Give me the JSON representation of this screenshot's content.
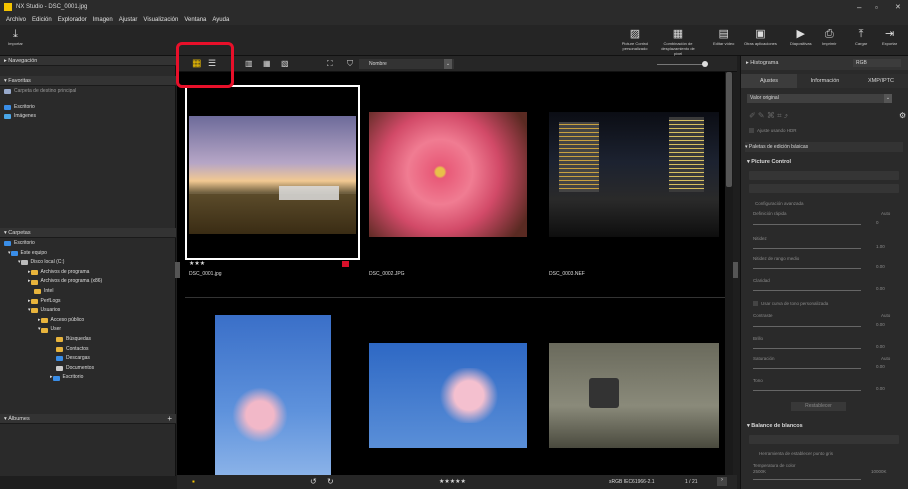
{
  "window": {
    "title": "NX Studio - DSC_0001.jpg",
    "controls": [
      "–",
      "▫",
      "✕"
    ]
  },
  "menu": [
    "Archivo",
    "Edición",
    "Explorador",
    "Imagen",
    "Ajustar",
    "Visualización",
    "Ventana",
    "Ayuda"
  ],
  "toolbar": {
    "import_label": "Importar",
    "buttons": [
      {
        "icon": "picture-control-icon",
        "label": "Picture Control personalizado"
      },
      {
        "icon": "pixel-shift-icon",
        "label": "Combinación de desplazamiento de píxel"
      },
      {
        "icon": "video-edit-icon",
        "label": "Editar vídeo"
      },
      {
        "icon": "other-apps-icon",
        "label": "Otras aplicaciones"
      },
      {
        "icon": "slideshow-icon",
        "label": "Diapositivas"
      },
      {
        "icon": "print-icon",
        "label": "Imprimir"
      },
      {
        "icon": "upload-icon",
        "label": "Cargar"
      },
      {
        "icon": "export-icon",
        "label": "Exportar"
      }
    ]
  },
  "left": {
    "nav_header": "Navegación",
    "fav_header": "Favoritas",
    "fav_items": [
      "Carpeta de destino principal",
      "Escritorio",
      "Imágenes"
    ],
    "folders_header": "Carpetas",
    "folders": [
      "Escritorio",
      "Este equipo",
      "Disco local (C:)",
      "Archivos de programa",
      "Archivos de programa (x86)",
      "Intel",
      "PerfLogs",
      "Usuarios",
      "Acceso público",
      "User",
      "Búsquedas",
      "Contactos",
      "Descargas",
      "Documentos",
      "Escritorio"
    ],
    "albums_header": "Álbumes"
  },
  "browser": {
    "sort_label": "Nombre",
    "thumbs": [
      {
        "name": "DSC_0001.jpg",
        "rating": "★★★",
        "selected": true
      },
      {
        "name": "DSC_0002.JPG"
      },
      {
        "name": "DSC_0003.NEF"
      },
      {
        "name": ""
      },
      {
        "name": ""
      },
      {
        "name": ""
      }
    ]
  },
  "status": {
    "colorspace": "sRGB IEC61966-2.1",
    "page": "1 / 21",
    "stars": "★★★★★"
  },
  "right": {
    "histogram_label": "Histograma",
    "channel": "RGB",
    "tabs": [
      "Ajustes",
      "Información",
      "XMP/IPTC"
    ],
    "preset": "Valor original",
    "hdr_label": "Ajuste usando HDR",
    "basic_palettes": "Paletas de edición básicas",
    "picture_control": "Picture Control",
    "advanced": "Configuración avanzada",
    "sliders": [
      {
        "label": "Definición rápida",
        "auto": "Auto",
        "value": "0"
      },
      {
        "label": "Nitidez",
        "value": "1.00"
      },
      {
        "label": "Nitidez de rango medio",
        "value": "0.00"
      },
      {
        "label": "Claridad",
        "value": "0.00"
      },
      {
        "label": "Contraste",
        "auto": "Auto",
        "value": "0.00"
      },
      {
        "label": "Brillo",
        "value": "0.00"
      },
      {
        "label": "Saturación",
        "auto": "Auto",
        "value": "0.00"
      },
      {
        "label": "Tono",
        "value": "0.00"
      }
    ],
    "tone_curve": "Usar curva de tono personalizada",
    "reset": "Restablecer",
    "wb_header": "Balance de blancos",
    "wb_tool": "Herramienta de establecer punto gris",
    "temp_label": "Temperatura de color",
    "temp_min": "2500K",
    "temp_max": "10000K"
  }
}
